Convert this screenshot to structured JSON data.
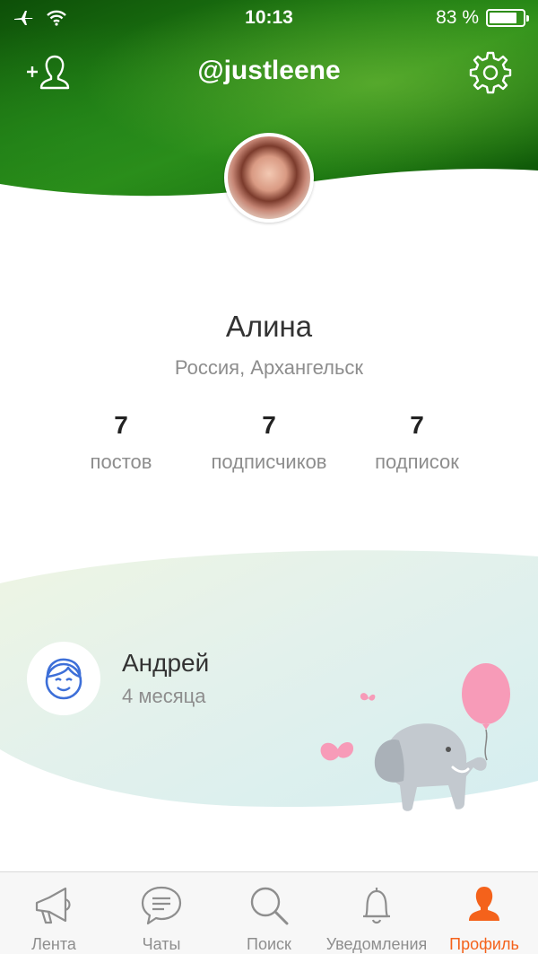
{
  "status_bar": {
    "time": "10:13",
    "battery": "83 %",
    "battery_level": 0.83
  },
  "header": {
    "username": "@justleene"
  },
  "profile": {
    "name": "Алина",
    "location": "Россия, Архангельск",
    "stats": [
      {
        "value": "7",
        "label": "постов"
      },
      {
        "value": "7",
        "label": "подписчиков"
      },
      {
        "value": "7",
        "label": "подписок"
      }
    ]
  },
  "relationship": {
    "name": "Андрей",
    "duration": "4 месяца"
  },
  "tab_bar": {
    "tabs": [
      {
        "label": "Лента",
        "icon": "megaphone-icon",
        "active": false
      },
      {
        "label": "Чаты",
        "icon": "chat-icon",
        "active": false
      },
      {
        "label": "Поиск",
        "icon": "search-icon",
        "active": false
      },
      {
        "label": "Уведомления",
        "icon": "bell-icon",
        "active": false
      },
      {
        "label": "Профиль",
        "icon": "profile-icon",
        "active": true
      }
    ]
  },
  "colors": {
    "accent": "#f4621b",
    "header_green": "#1e7a12",
    "relationship_icon_blue": "#3d6fd8",
    "balloon_pink": "#f79bb8"
  }
}
